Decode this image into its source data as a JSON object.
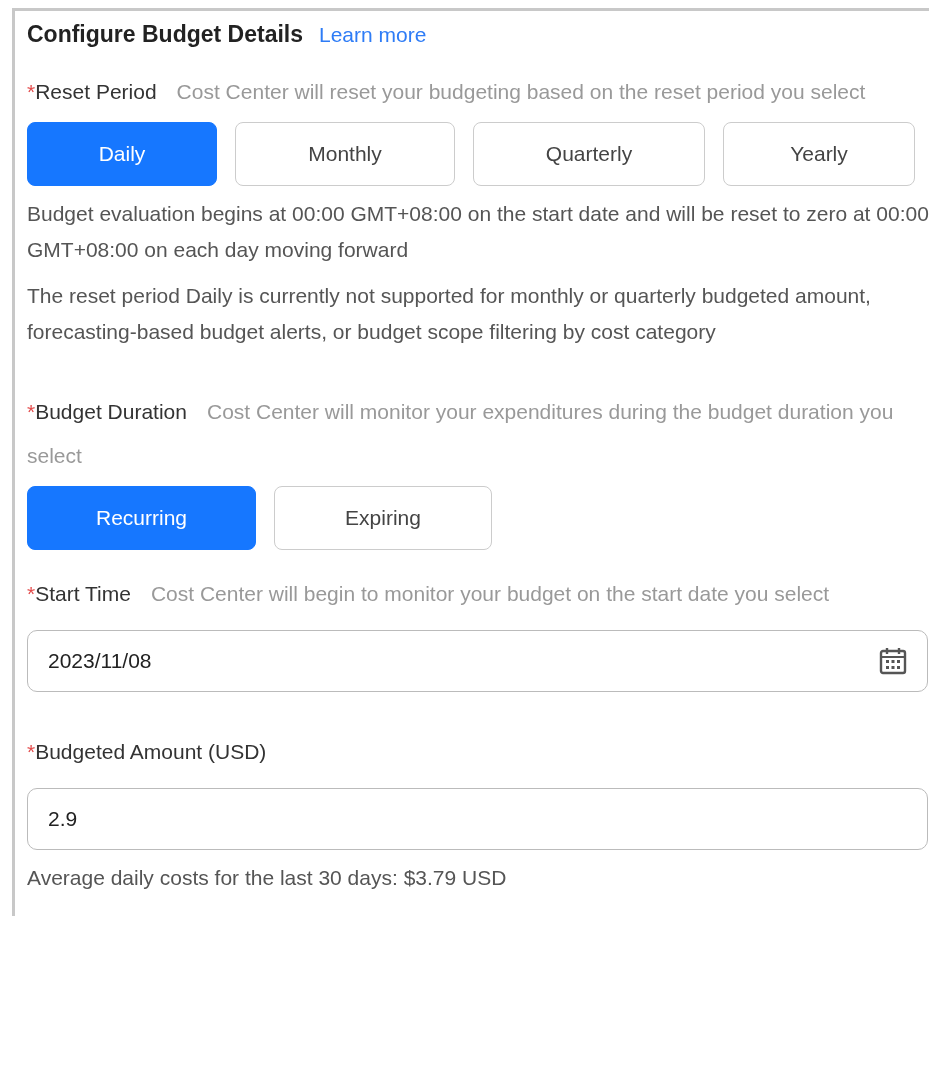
{
  "title": "Configure Budget Details",
  "learn_more": "Learn more",
  "fields": [
    {
      "kind": "options",
      "required": "*",
      "label": "Reset Period",
      "hint": "Cost Center will reset your budgeting based on the reset period you select",
      "options": [
        {
          "label": "Daily",
          "selected": true
        },
        {
          "label": "Monthly",
          "selected": false
        },
        {
          "label": "Quarterly",
          "selected": false
        },
        {
          "label": "Yearly",
          "selected": false
        }
      ],
      "notes": [
        "Budget evaluation begins at 00:00 GMT+08:00 on the start date and will be reset to zero at 00:00 GMT+08:00 on each day moving forward",
        "The reset period Daily is currently not supported for monthly or quarterly budgeted amount, forecasting-based budget alerts, or budget scope filtering by cost category"
      ]
    },
    {
      "kind": "options",
      "required": "*",
      "label": "Budget Duration",
      "hint": "Cost Center will monitor your expenditures during the budget duration you select",
      "options": [
        {
          "label": "Recurring",
          "selected": true
        },
        {
          "label": "Expiring",
          "selected": false
        }
      ]
    },
    {
      "kind": "date",
      "required": "*",
      "label": "Start Time",
      "hint": "Cost Center will begin to monitor your budget on the start date you select",
      "value": "2023/11/08"
    },
    {
      "kind": "input",
      "required": "*",
      "label": "Budgeted Amount (USD)",
      "value": "2.9",
      "notes": [
        "Average daily costs for the last 30 days: $3.79 USD"
      ]
    }
  ]
}
